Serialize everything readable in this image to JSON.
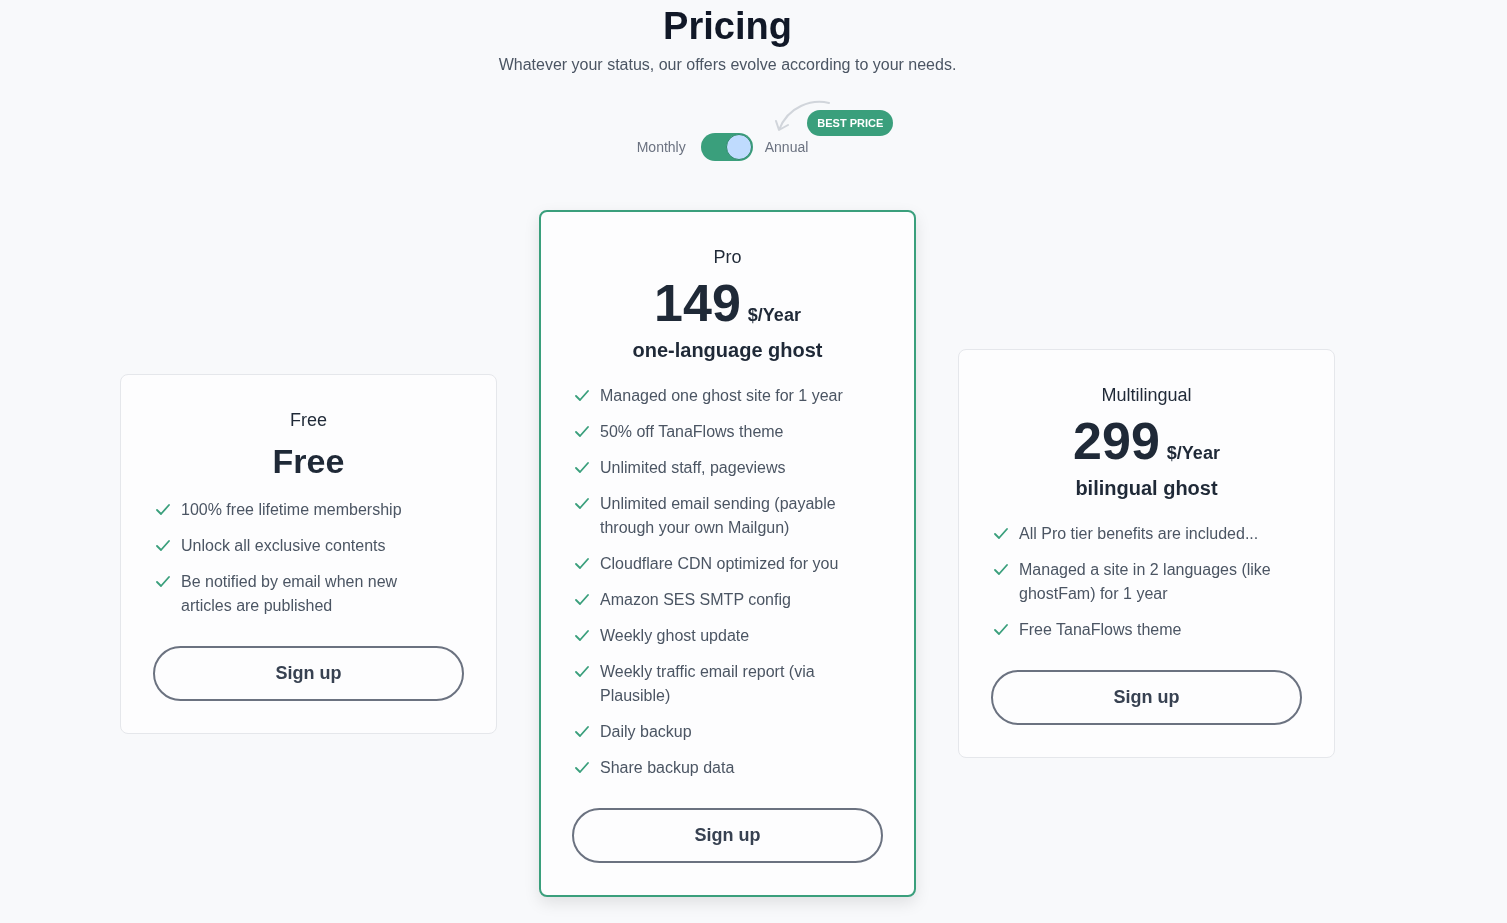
{
  "header": {
    "title": "Pricing",
    "subtitle": "Whatever your status, our offers evolve according to your needs."
  },
  "billing": {
    "monthly_label": "Monthly",
    "switch": {
      "on": true
    },
    "annual_label": "Annual",
    "badge": "BEST PRICE"
  },
  "plans": [
    {
      "kind": "free",
      "highlighted": false,
      "name": "Free",
      "price": "Free",
      "features": [
        "100% free lifetime membership",
        "Unlock all exclusive contents",
        "Be notified by email when new articles are published"
      ],
      "button": "Sign up"
    },
    {
      "kind": "paid",
      "highlighted": true,
      "name": "Pro",
      "price": "149",
      "period": "$/Year",
      "tagline": "one-language ghost",
      "features": [
        "Managed one ghost site for 1 year",
        "50% off TanaFlows theme",
        "Unlimited staff, pageviews",
        "Unlimited email sending (payable through your own Mailgun)",
        "Cloudflare CDN optimized for you",
        "Amazon SES SMTP config",
        "Weekly ghost update",
        "Weekly traffic email report (via Plausible)",
        "Daily backup",
        "Share backup data"
      ],
      "button": "Sign up"
    },
    {
      "kind": "paid",
      "highlighted": false,
      "name": "Multilingual",
      "price": "299",
      "period": "$/Year",
      "tagline": "bilingual ghost",
      "features": [
        "All Pro tier benefits are included...",
        "Managed a site in 2 languages (like ghostFam) for 1 year",
        "Free TanaFlows theme"
      ],
      "button": "Sign up"
    }
  ]
}
